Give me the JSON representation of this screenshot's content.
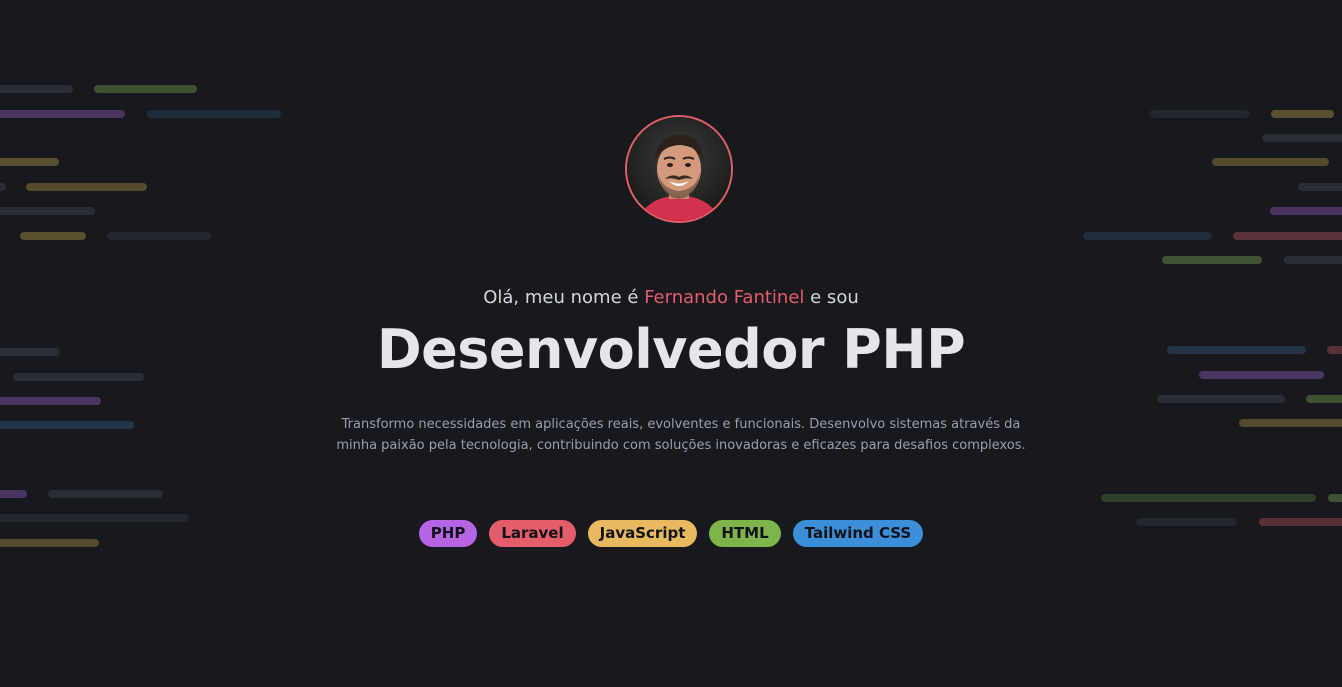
{
  "hero": {
    "intro_prefix": "Olá, meu nome é",
    "intro_name": "Fernando Fantinel",
    "intro_suffix": "e sou",
    "headline": "Desenvolvedor PHP",
    "description": "Transformo necessidades em aplicações reais, evolventes e funcionais. Desenvolvo sistemas através da minha paixão pela tecnologia, contribuindo com soluções inovadoras e eficazes para desafios complexos."
  },
  "skills": [
    {
      "label": "PHP",
      "color": "#b565e3"
    },
    {
      "label": "Laravel",
      "color": "#e35d6a"
    },
    {
      "label": "JavaScript",
      "color": "#e8b95f"
    },
    {
      "label": "HTML",
      "color": "#7fb44a"
    },
    {
      "label": "Tailwind CSS",
      "color": "#3b8fd9"
    }
  ],
  "colors": {
    "background": "#18191f",
    "accent": "#e35d6a",
    "headline": "#e4e6ec",
    "muted_text": "#9a9eae"
  }
}
